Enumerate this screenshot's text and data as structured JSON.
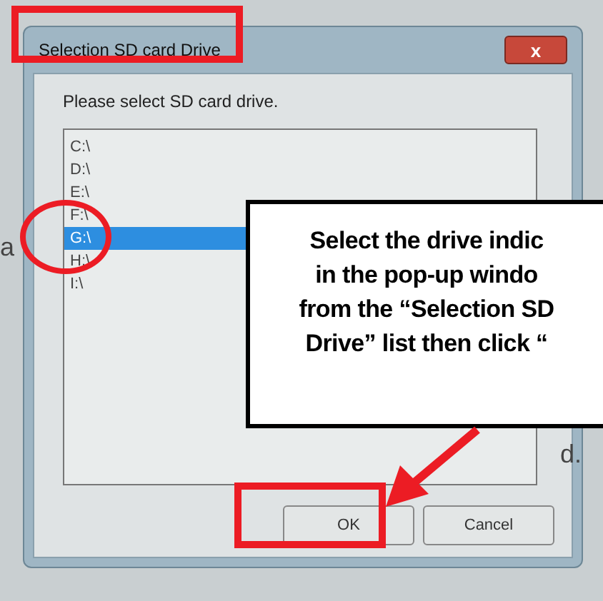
{
  "background_text": [
    "a",
    "d."
  ],
  "dialog": {
    "title": "Selection SD card Drive",
    "close": "x",
    "prompt": "Please select SD card drive.",
    "drives": [
      {
        "label": "C:\\",
        "selected": false
      },
      {
        "label": "D:\\",
        "selected": false
      },
      {
        "label": "E:\\",
        "selected": false
      },
      {
        "label": "F:\\",
        "selected": false
      },
      {
        "label": "G:\\",
        "selected": true
      },
      {
        "label": "H:\\",
        "selected": false
      },
      {
        "label": "I:\\",
        "selected": false
      }
    ],
    "buttons": [
      "OK",
      "Cancel"
    ]
  },
  "callout": {
    "lines": [
      "Select the drive indic",
      "in the pop-up windo",
      "from the “Selection SD",
      "Drive” list then click “"
    ]
  }
}
